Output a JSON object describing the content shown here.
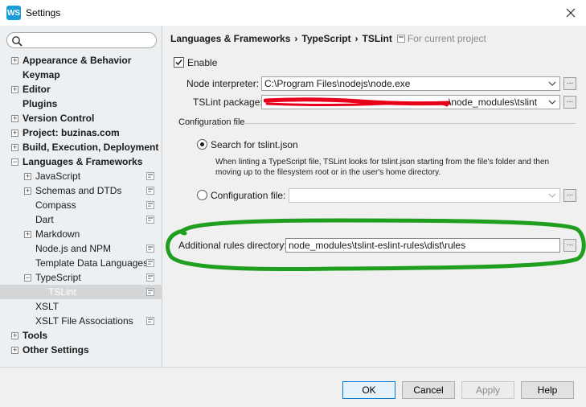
{
  "window": {
    "title": "Settings",
    "app_icon": "WS"
  },
  "search": {
    "value": "",
    "placeholder": ""
  },
  "sidebar": {
    "items": [
      {
        "label": "Appearance & Behavior",
        "level": 0,
        "bold": true,
        "expander": "+",
        "project": false,
        "selected": false
      },
      {
        "label": "Keymap",
        "level": 0,
        "bold": true,
        "expander": "",
        "project": false,
        "selected": false
      },
      {
        "label": "Editor",
        "level": 0,
        "bold": true,
        "expander": "+",
        "project": false,
        "selected": false
      },
      {
        "label": "Plugins",
        "level": 0,
        "bold": true,
        "expander": "",
        "project": false,
        "selected": false
      },
      {
        "label": "Version Control",
        "level": 0,
        "bold": true,
        "expander": "+",
        "project": false,
        "selected": false
      },
      {
        "label": "Project: buzinas.com",
        "level": 0,
        "bold": true,
        "expander": "+",
        "project": false,
        "selected": false
      },
      {
        "label": "Build, Execution, Deployment",
        "level": 0,
        "bold": true,
        "expander": "+",
        "project": false,
        "selected": false
      },
      {
        "label": "Languages & Frameworks",
        "level": 0,
        "bold": true,
        "expander": "−",
        "project": false,
        "selected": false
      },
      {
        "label": "JavaScript",
        "level": 1,
        "bold": false,
        "expander": "+",
        "project": true,
        "selected": false
      },
      {
        "label": "Schemas and DTDs",
        "level": 1,
        "bold": false,
        "expander": "+",
        "project": true,
        "selected": false
      },
      {
        "label": "Compass",
        "level": 1,
        "bold": false,
        "expander": "",
        "project": true,
        "selected": false
      },
      {
        "label": "Dart",
        "level": 1,
        "bold": false,
        "expander": "",
        "project": true,
        "selected": false
      },
      {
        "label": "Markdown",
        "level": 1,
        "bold": false,
        "expander": "+",
        "project": false,
        "selected": false
      },
      {
        "label": "Node.js and NPM",
        "level": 1,
        "bold": false,
        "expander": "",
        "project": true,
        "selected": false
      },
      {
        "label": "Template Data Languages",
        "level": 1,
        "bold": false,
        "expander": "",
        "project": true,
        "selected": false
      },
      {
        "label": "TypeScript",
        "level": 1,
        "bold": false,
        "expander": "−",
        "project": true,
        "selected": false
      },
      {
        "label": "TSLint",
        "level": 2,
        "bold": false,
        "expander": "",
        "project": true,
        "selected": true
      },
      {
        "label": "XSLT",
        "level": 1,
        "bold": false,
        "expander": "",
        "project": false,
        "selected": false
      },
      {
        "label": "XSLT File Associations",
        "level": 1,
        "bold": false,
        "expander": "",
        "project": true,
        "selected": false
      },
      {
        "label": "Tools",
        "level": 0,
        "bold": true,
        "expander": "+",
        "project": false,
        "selected": false
      },
      {
        "label": "Other Settings",
        "level": 0,
        "bold": true,
        "expander": "+",
        "project": false,
        "selected": false
      }
    ]
  },
  "breadcrumb": {
    "parts": [
      "Languages & Frameworks",
      "TypeScript",
      "TSLint"
    ],
    "separator": "›",
    "scope": "For current project"
  },
  "form": {
    "enable_label": "Enable",
    "enable_checked": true,
    "node_interpreter_label": "Node interpreter:",
    "node_interpreter_value": "C:\\Program Files\\nodejs\\node.exe",
    "tslint_package_label": "TSLint package:",
    "tslint_package_value": "\\node_modules\\tslint",
    "config_group_label": "Configuration file",
    "search_option_label": "Search for tslint.json",
    "search_option_selected": true,
    "search_description": "When linting a TypeScript file, TSLint looks for tslint.json starting from the file's folder and then moving up to the filesystem root or in the user's home directory.",
    "config_option_label": "Configuration file:",
    "config_file_value": "",
    "rules_dir_label": "Additional rules directory:",
    "rules_dir_value": "node_modules\\tslint-eslint-rules\\dist\\rules",
    "browse_label": "..."
  },
  "buttons": {
    "ok": "OK",
    "cancel": "Cancel",
    "apply": "Apply",
    "help": "Help"
  },
  "colors": {
    "highlight_ring": "#1f9e1f",
    "redaction": "#e8001a",
    "selection": "#d4d6d8"
  }
}
